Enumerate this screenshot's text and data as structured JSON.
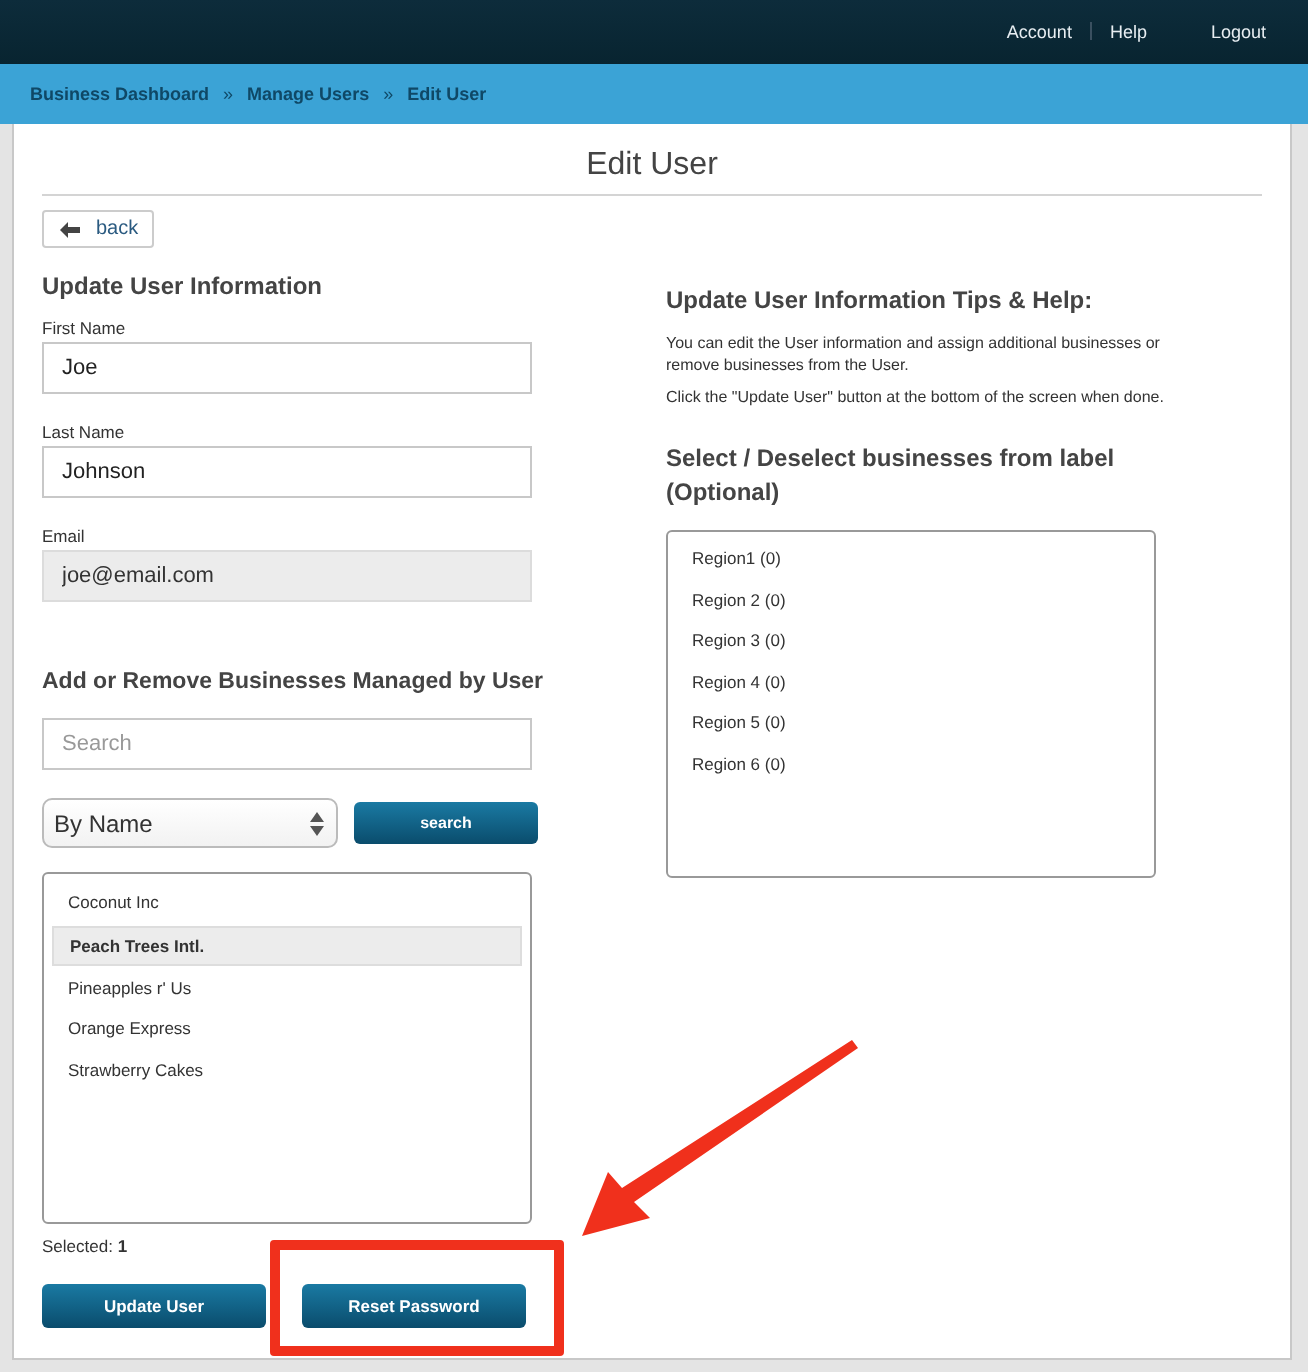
{
  "top_nav": [
    {
      "label": "Account"
    },
    {
      "label": "Help"
    },
    {
      "label": "Logout"
    }
  ],
  "breadcrumb": [
    {
      "kind": "link",
      "text": "Business Dashboard"
    },
    {
      "kind": "separator",
      "text": "»"
    },
    {
      "kind": "link",
      "text": "Manage Users"
    },
    {
      "kind": "separator",
      "text": "»"
    },
    {
      "kind": "link",
      "text": "Edit User"
    }
  ],
  "page_title": "Edit User",
  "back_button": "back",
  "left": {
    "heading": "Update User Information",
    "fields": [
      {
        "label": "First Name",
        "value": "Joe",
        "disabled": false
      },
      {
        "label": "Last Name",
        "value": "Johnson",
        "disabled": false
      },
      {
        "label": "Email",
        "value": "joe@email.com",
        "disabled": true
      }
    ],
    "businesses_heading": "Add or Remove Businesses Managed by User",
    "search": {
      "placeholder": "Search"
    },
    "sort_select": "By Name",
    "search_button": "search",
    "businesses": [
      {
        "name": "Coconut Inc",
        "selected": false
      },
      {
        "name": "Peach Trees Intl.",
        "selected": true
      },
      {
        "name": "Pineapples r' Us",
        "selected": false
      },
      {
        "name": "Orange Express",
        "selected": false
      },
      {
        "name": "Strawberry Cakes",
        "selected": false
      }
    ],
    "selected_count": "Selected: **1**",
    "buttons": [
      "Update User",
      "Reset Password"
    ]
  },
  "right": {
    "heading": "Update User Information Tips & Help:",
    "paragraphs": [
      "You can edit the User information and assign additional businesses or remove businesses from the User.",
      "Click the \"Update User\" button at the bottom of the screen when done."
    ],
    "labels_heading": "Select / Deselect businesses from label (Optional)",
    "labels": [
      {
        "name": "Region1 (0)",
        "selected": false
      },
      {
        "name": "Region 2 (0)",
        "selected": false
      },
      {
        "name": "Region 3 (0)",
        "selected": false
      },
      {
        "name": "Region 4 (0)",
        "selected": false
      },
      {
        "name": "Region 5 (0)",
        "selected": false
      },
      {
        "name": "Region 6 (0)",
        "selected": false
      }
    ]
  }
}
